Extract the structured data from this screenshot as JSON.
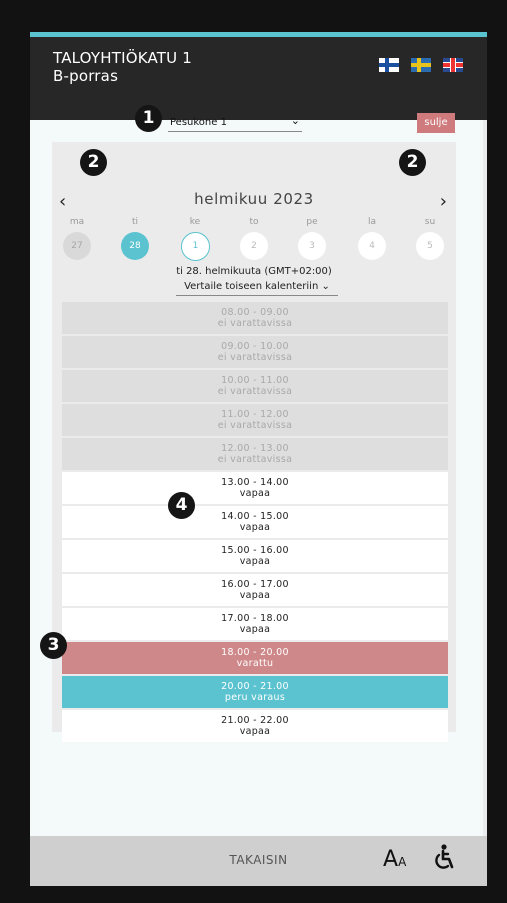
{
  "header": {
    "line1": "TALOYHTIÖKATU 1",
    "line2": "B-porras",
    "flags": [
      "fi-flag-icon",
      "se-flag-icon",
      "uk-flag-icon"
    ]
  },
  "machine_select": {
    "value": "Pesukone 1",
    "chevron": "⌄"
  },
  "close_label": "sulje",
  "calendar": {
    "month": "helmikuu 2023",
    "prev": "‹",
    "next": "›",
    "weekdays": [
      "ma",
      "ti",
      "ke",
      "to",
      "pe",
      "la",
      "su"
    ],
    "days": [
      "27",
      "28",
      "1",
      "2",
      "3",
      "4",
      "5"
    ],
    "selected_date": "ti 28. helmikuuta (GMT+02:00)",
    "compare_label": "Vertaile toiseen kalenteriin",
    "compare_chevron": "⌄"
  },
  "slots": [
    {
      "time": "08.00 - 09.00",
      "status": "ei varattavissa"
    },
    {
      "time": "09.00 - 10.00",
      "status": "ei varattavissa"
    },
    {
      "time": "10.00 - 11.00",
      "status": "ei varattavissa"
    },
    {
      "time": "11.00 - 12.00",
      "status": "ei varattavissa"
    },
    {
      "time": "12.00 - 13.00",
      "status": "ei varattavissa"
    },
    {
      "time": "13.00 - 14.00",
      "status": "vapaa"
    },
    {
      "time": "14.00 - 15.00",
      "status": "vapaa"
    },
    {
      "time": "15.00 - 16.00",
      "status": "vapaa"
    },
    {
      "time": "16.00 - 17.00",
      "status": "vapaa"
    },
    {
      "time": "17.00 - 18.00",
      "status": "vapaa"
    },
    {
      "time": "18.00 - 20.00",
      "status": "varattu"
    },
    {
      "time": "20.00 - 21.00",
      "status": "peru varaus"
    },
    {
      "time": "21.00 - 22.00",
      "status": "vapaa"
    }
  ],
  "footer": {
    "back_label": "TAKAISIN",
    "fontsize_big": "A",
    "fontsize_small": "A"
  },
  "markers": [
    "1",
    "2",
    "2",
    "3",
    "4"
  ],
  "colors": {
    "accent": "#5bc3d0",
    "booked": "#cf8889",
    "close": "#cf7b7e",
    "header": "#272727"
  }
}
